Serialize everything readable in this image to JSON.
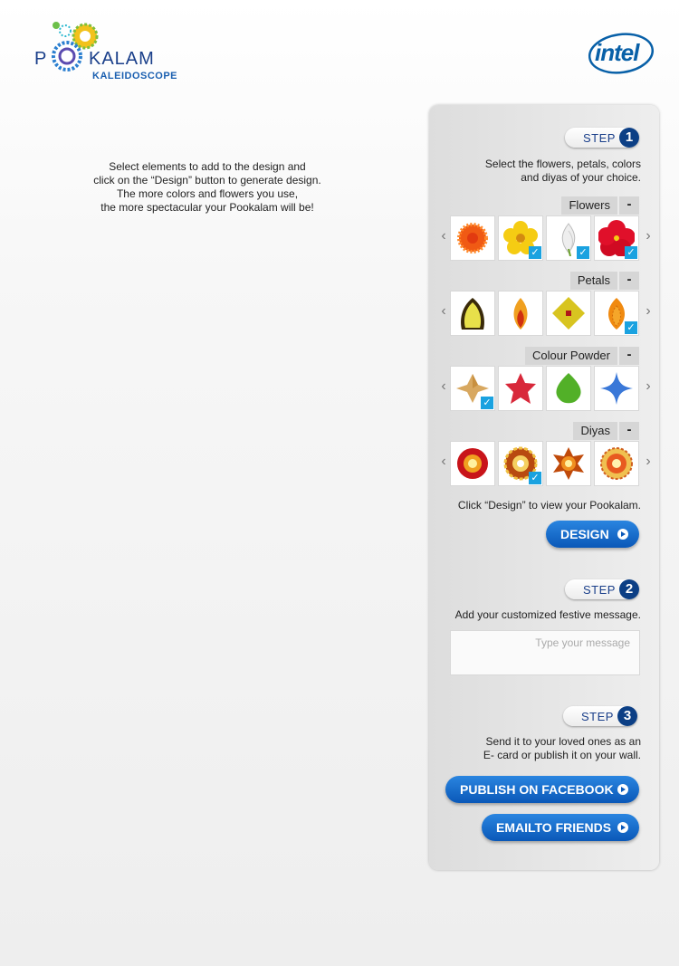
{
  "header": {
    "logo": {
      "word_p": "P",
      "word_kalam": "KALAM",
      "subtitle": "KALEIDOSCOPE",
      "icon": "pookalam-gear-logo"
    },
    "intel_logo": {
      "text": "intel",
      "icon": "intel-logo"
    }
  },
  "intro": {
    "lines": [
      "Select elements to add to the design and",
      "click on the “Design” button to generate design.",
      "The more colors and flowers you use,",
      "the more spectacular your Pookalam will be!"
    ]
  },
  "step1": {
    "label": "STEP",
    "number": "1",
    "desc_lines": [
      "Select the flowers, petals, colors",
      "and diyas of your choice."
    ],
    "categories": [
      {
        "name": "Flowers",
        "toggle": "-",
        "items": [
          {
            "icon": "orange-marigold-flower",
            "checked": false
          },
          {
            "icon": "yellow-flower",
            "checked": true
          },
          {
            "icon": "white-lily-flower",
            "checked": true
          },
          {
            "icon": "red-hibiscus-flower",
            "checked": true
          }
        ]
      },
      {
        "name": "Petals",
        "toggle": "-",
        "items": [
          {
            "icon": "yellow-dotted-petal",
            "checked": false
          },
          {
            "icon": "orange-red-petal",
            "checked": false
          },
          {
            "icon": "yellow-diamond-petal",
            "checked": false
          },
          {
            "icon": "orange-petal",
            "checked": true
          }
        ]
      },
      {
        "name": "Colour Powder",
        "toggle": "-",
        "items": [
          {
            "icon": "tan-star-powder",
            "checked": true
          },
          {
            "icon": "red-star-powder",
            "checked": false
          },
          {
            "icon": "green-leaf-powder",
            "checked": false
          },
          {
            "icon": "blue-star-powder",
            "checked": false
          }
        ]
      },
      {
        "name": "Diyas",
        "toggle": "-",
        "items": [
          {
            "icon": "red-diya",
            "checked": false
          },
          {
            "icon": "gold-diya",
            "checked": true
          },
          {
            "icon": "orange-star-diya",
            "checked": false
          },
          {
            "icon": "floral-diya",
            "checked": false
          }
        ]
      }
    ],
    "hint": "Click “Design” to view your Pookalam.",
    "design_button": "DESIGN"
  },
  "step2": {
    "label": "STEP",
    "number": "2",
    "desc": "Add your customized festive message.",
    "message_placeholder": "Type your message"
  },
  "step3": {
    "label": "STEP",
    "number": "3",
    "desc_lines": [
      "Send it to your loved ones as an",
      "E- card or publish it on your wall."
    ],
    "publish_button": "PUBLISH ON FACEBOOK",
    "email_button": "EMAILTO FRIENDS"
  },
  "colors": {
    "brand_blue": "#0c3f85",
    "button_blue": "#0a58b8",
    "check_blue": "#1aa2e0"
  }
}
